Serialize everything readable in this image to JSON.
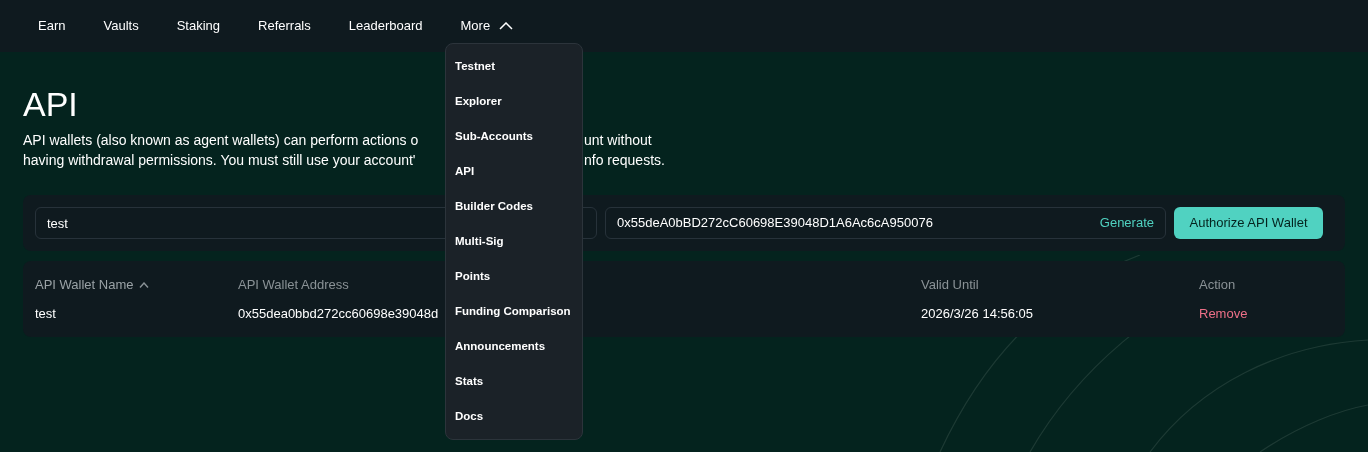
{
  "nav": {
    "items": [
      {
        "label": "Earn"
      },
      {
        "label": "Vaults"
      },
      {
        "label": "Staking"
      },
      {
        "label": "Referrals"
      },
      {
        "label": "Leaderboard"
      }
    ],
    "more": {
      "label": "More",
      "expanded": true,
      "menu": [
        "Testnet",
        "Explorer",
        "Sub-Accounts",
        "API",
        "Builder Codes",
        "Multi-Sig",
        "Points",
        "Funding Comparison",
        "Announcements",
        "Stats",
        "Docs"
      ]
    }
  },
  "page": {
    "title": "API",
    "description": [
      {
        "left": "API wallets (also known as agent wallets) can perform actions o",
        "right": "unt without"
      },
      {
        "left": "having withdrawal permissions. You must still use your account'",
        "right": "nfo requests."
      }
    ]
  },
  "form": {
    "name_value": "test",
    "address_value": "0x55deA0bBD272cC60698E39048D1A6Ac6cA950076",
    "generate": "Generate",
    "submit": "Authorize API Wallet"
  },
  "table": {
    "columns": [
      {
        "label": "API Wallet Name",
        "sorted": true
      },
      {
        "label": "API Wallet Address",
        "sorted": false
      },
      {
        "label": "Valid Until",
        "sorted": false
      },
      {
        "label": "Action",
        "sorted": false
      }
    ],
    "rows": [
      {
        "name": "test",
        "address": "0x55dea0bbd272cc60698e39048d",
        "valid_until": "2026/3/26 14:56:05",
        "action": "Remove"
      }
    ]
  }
}
